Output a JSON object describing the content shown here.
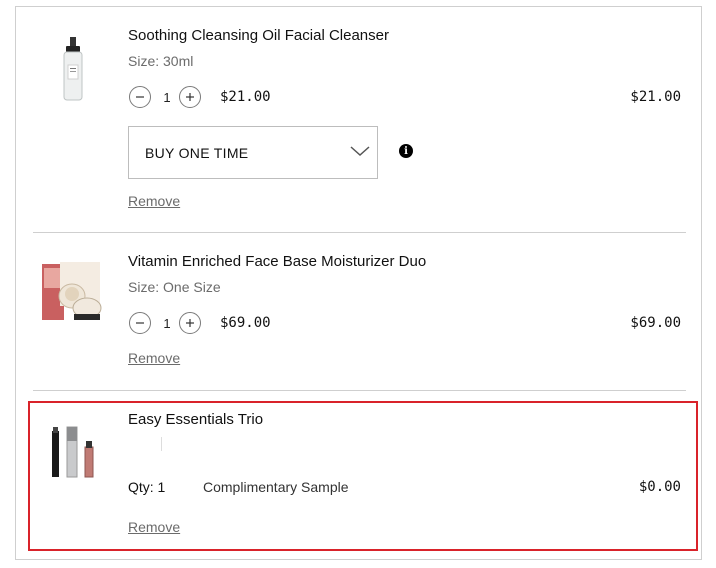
{
  "items": [
    {
      "name": "Soothing Cleansing Oil Facial Cleanser",
      "size": "Size: 30ml",
      "qty": "1",
      "unit_price": "$21.00",
      "total": "$21.00",
      "purchase_option": "BUY ONE TIME",
      "info_glyph": "i",
      "remove": "Remove"
    },
    {
      "name": "Vitamin Enriched Face Base Moisturizer Duo",
      "size": "Size: One Size",
      "qty": "1",
      "unit_price": "$69.00",
      "total": "$69.00",
      "remove": "Remove"
    },
    {
      "name": "Easy Essentials Trio",
      "qty_label": "Qty: 1",
      "note": "Complimentary Sample",
      "total": "$0.00",
      "remove": "Remove"
    }
  ],
  "colors": {
    "highlight": "#d9232a",
    "border": "#cfcfcf",
    "muted_text": "#6b6b6b"
  },
  "icons": [
    "minus-icon",
    "plus-icon",
    "chevron-down-icon",
    "info-icon"
  ]
}
